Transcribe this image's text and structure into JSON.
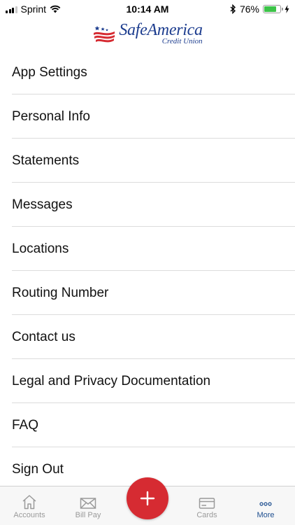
{
  "status_bar": {
    "carrier": "Sprint",
    "time": "10:14 AM",
    "battery_percent": "76%",
    "battery_level": 0.76
  },
  "header": {
    "logo_name": "SafeAmerica",
    "logo_subtitle": "Credit Union",
    "colors": {
      "brand_blue": "#1d3d8f",
      "brand_red": "#d62b32"
    }
  },
  "menu": {
    "items": [
      {
        "label": "App Settings"
      },
      {
        "label": "Personal Info"
      },
      {
        "label": "Statements"
      },
      {
        "label": "Messages"
      },
      {
        "label": "Locations"
      },
      {
        "label": "Routing Number"
      },
      {
        "label": "Contact us"
      },
      {
        "label": "Legal and Privacy Documentation"
      },
      {
        "label": "FAQ"
      },
      {
        "label": "Sign Out"
      }
    ]
  },
  "tab_bar": {
    "tabs": [
      {
        "label": "Accounts",
        "icon": "house-icon"
      },
      {
        "label": "Bill Pay",
        "icon": "envelope-icon"
      },
      {
        "label": "Cards",
        "icon": "credit-card-icon"
      },
      {
        "label": "More",
        "icon": "ellipsis-icon",
        "active": true
      }
    ],
    "fab_icon": "plus-icon",
    "colors": {
      "active": "#1d4e8f",
      "inactive": "#9a9a9a",
      "fab": "#d62b32"
    }
  }
}
